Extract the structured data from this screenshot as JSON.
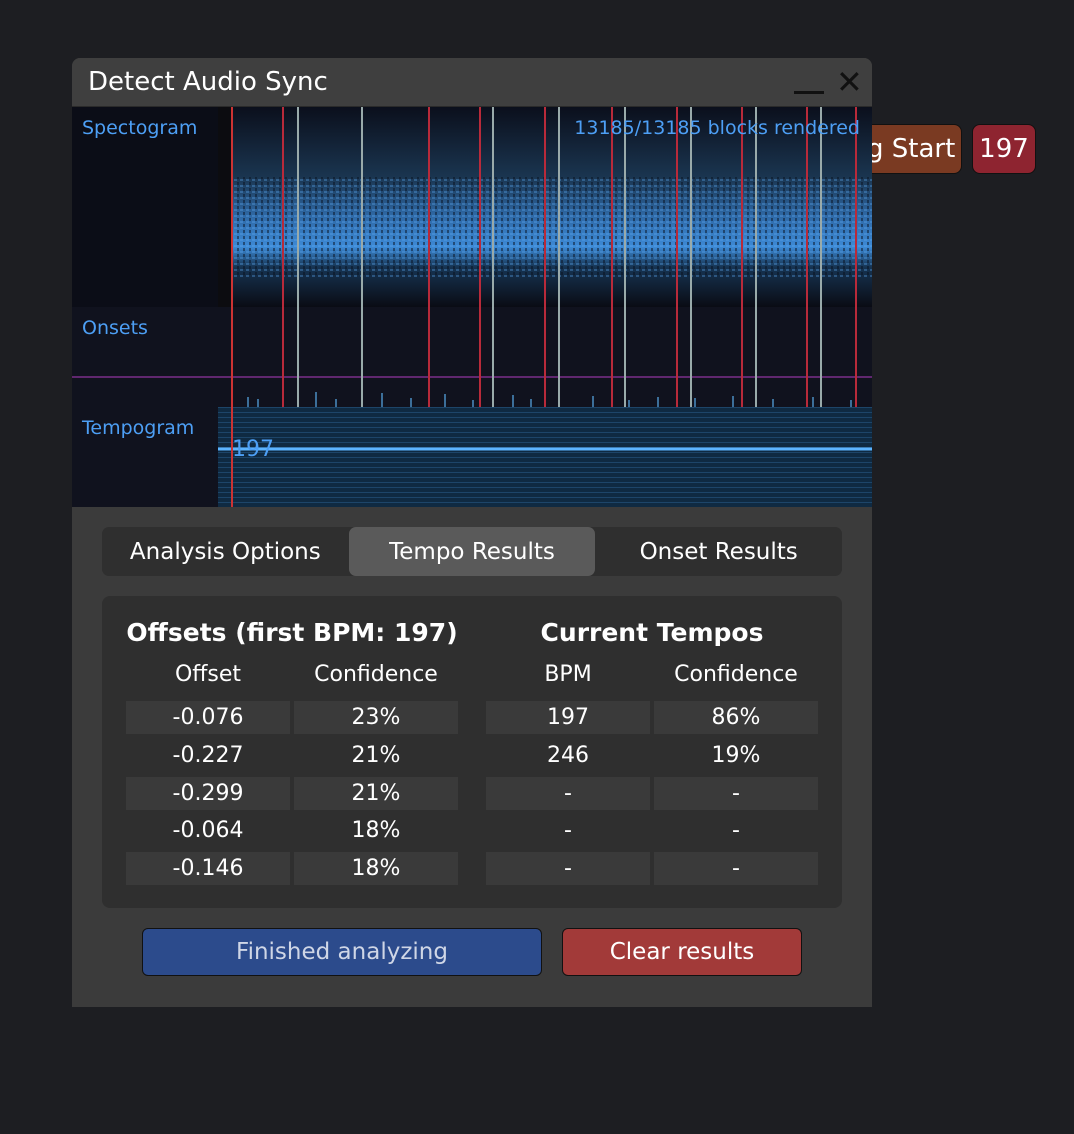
{
  "background": {
    "chip_start_label": "g Start",
    "chip_bpm_label": "197"
  },
  "window": {
    "title": "Detect Audio Sync"
  },
  "viz": {
    "spectrogram_label": "Spectogram",
    "onsets_label": "Onsets",
    "tempogram_label": "Tempogram",
    "status": "13185/13185 blocks rendered",
    "tempo_marker": "197"
  },
  "tabs": [
    {
      "label": "Analysis Options"
    },
    {
      "label": "Tempo Results"
    },
    {
      "label": "Onset Results"
    }
  ],
  "offsets": {
    "title": "Offsets (first BPM: 197)",
    "headers": [
      "Offset",
      "Confidence"
    ],
    "rows": [
      [
        "-0.076",
        "23%"
      ],
      [
        "-0.227",
        "21%"
      ],
      [
        "-0.299",
        "21%"
      ],
      [
        "-0.064",
        "18%"
      ],
      [
        "-0.146",
        "18%"
      ]
    ]
  },
  "tempos": {
    "title": "Current Tempos",
    "headers": [
      "BPM",
      "Confidence"
    ],
    "rows": [
      [
        "197",
        "86%"
      ],
      [
        "246",
        "19%"
      ],
      [
        "-",
        "-"
      ],
      [
        "-",
        "-"
      ],
      [
        "-",
        "-"
      ]
    ]
  },
  "buttons": {
    "finish_label": "Finished analyzing",
    "clear_label": "Clear results"
  },
  "colors": {
    "accent_blue": "#4d9ff5",
    "clear_red": "#a23a39",
    "finish_blue": "#2c4b8c"
  }
}
